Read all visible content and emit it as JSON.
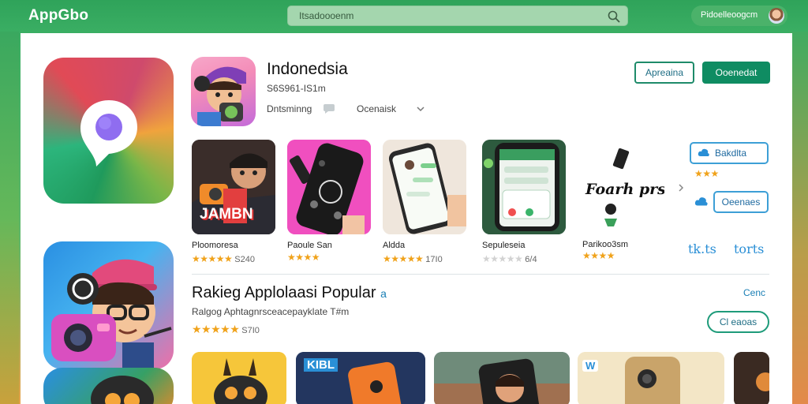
{
  "header": {
    "logo": "AppGbo",
    "search_placeholder": "Itsadoooenm",
    "user_name": "Pidoelleoogcm"
  },
  "app": {
    "title": "Indonedsia",
    "subtitle": "S6S961-IS1m",
    "category": "Dntsminng",
    "category2": "Ocenaisk",
    "btn_outline": "Apreaina",
    "btn_solid": "Ooenedat"
  },
  "screenshots": [
    {
      "label": "Ploomoresa",
      "stars": "★★★★★",
      "score": "S240"
    },
    {
      "label": "Paoule San",
      "stars": "★★★★",
      "score": ""
    },
    {
      "label": "Aldda",
      "stars": "★★★★★",
      "score": "17I0"
    },
    {
      "label": "Sepuleseia",
      "stars": "★★★★★",
      "score": "6/4"
    },
    {
      "label": "Parikoo3sm",
      "stars": "★★★★",
      "score": ""
    }
  ],
  "screenshot_art_text": {
    "shot1": "JAMBN",
    "shot5": "Foarh prs."
  },
  "side": {
    "btn1": "Bakdlta",
    "stars1": "★★★",
    "btn2": "Oeenaes",
    "tag1": "tk.ts",
    "tag2": "torts"
  },
  "popular": {
    "title": "Rakieg Applolaasi Popular",
    "badge": "a",
    "subtitle": "Ralgog Aphtagnrsceacepayklate T#m",
    "stars": "★★★★★",
    "score": "S7I0",
    "link_top": "Cenc",
    "link_btn": "Cl eaoas"
  },
  "bottom_cards": {
    "card2_label": "KIBL",
    "card4_label": "W"
  },
  "colors": {
    "brand_green": "#2fa35a",
    "primary_button": "#0f8c62",
    "star": "#f0a21a",
    "link": "#1a7fb5"
  },
  "icons": [
    "search-icon",
    "avatar",
    "chat-icon",
    "chevron-down-icon",
    "chevron-right-icon",
    "cloud-icon"
  ]
}
